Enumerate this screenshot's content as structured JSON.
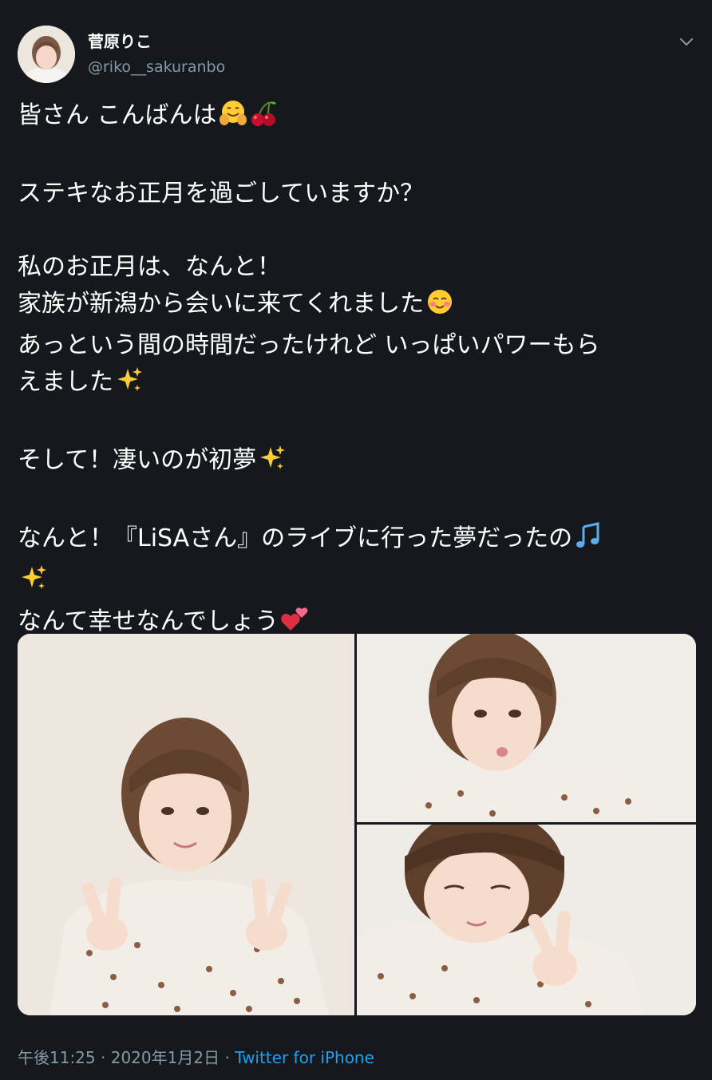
{
  "author": {
    "name": "菅原りこ",
    "handle": "@riko__sakuranbo"
  },
  "tweet": {
    "lines": [
      {
        "text": "皆さん こんばんは",
        "emojis": [
          "hugging-face-icon",
          "cherries-icon"
        ]
      },
      {
        "text": ""
      },
      {
        "text": "ステキなお正月を過ごしていますか？"
      },
      {
        "text": ""
      },
      {
        "text": "私のお正月は、なんと！"
      },
      {
        "text": "家族が新潟から会いに来てくれました",
        "emojis": [
          "smiling-blush-face-icon"
        ]
      },
      {
        "text": "あっという間の時間だったけれど いっぱいパワーもら"
      },
      {
        "text": "えました",
        "emojis": [
          "sparkles-icon"
        ]
      },
      {
        "text": ""
      },
      {
        "text": "そして！凄いのが初夢",
        "emojis": [
          "sparkles-icon"
        ]
      },
      {
        "text": ""
      },
      {
        "text": "なんと！『LiSAさん』のライブに行った夢だったの",
        "emojis": [
          "musical-notes-icon"
        ]
      },
      {
        "text": "",
        "emojis": [
          "sparkles-icon"
        ]
      },
      {
        "text": "なんて幸せなんでしょう",
        "emojis": [
          "two-hearts-icon"
        ]
      }
    ]
  },
  "meta": {
    "time": "午後11:25",
    "separator": "·",
    "date": "2020年1月2日",
    "source": "Twitter for iPhone"
  },
  "icons": {
    "menu": "chevron-down-icon"
  },
  "colors": {
    "background": "#15181c",
    "text": "#ffffff",
    "secondary": "#8899a6",
    "link": "#1da1f2"
  }
}
